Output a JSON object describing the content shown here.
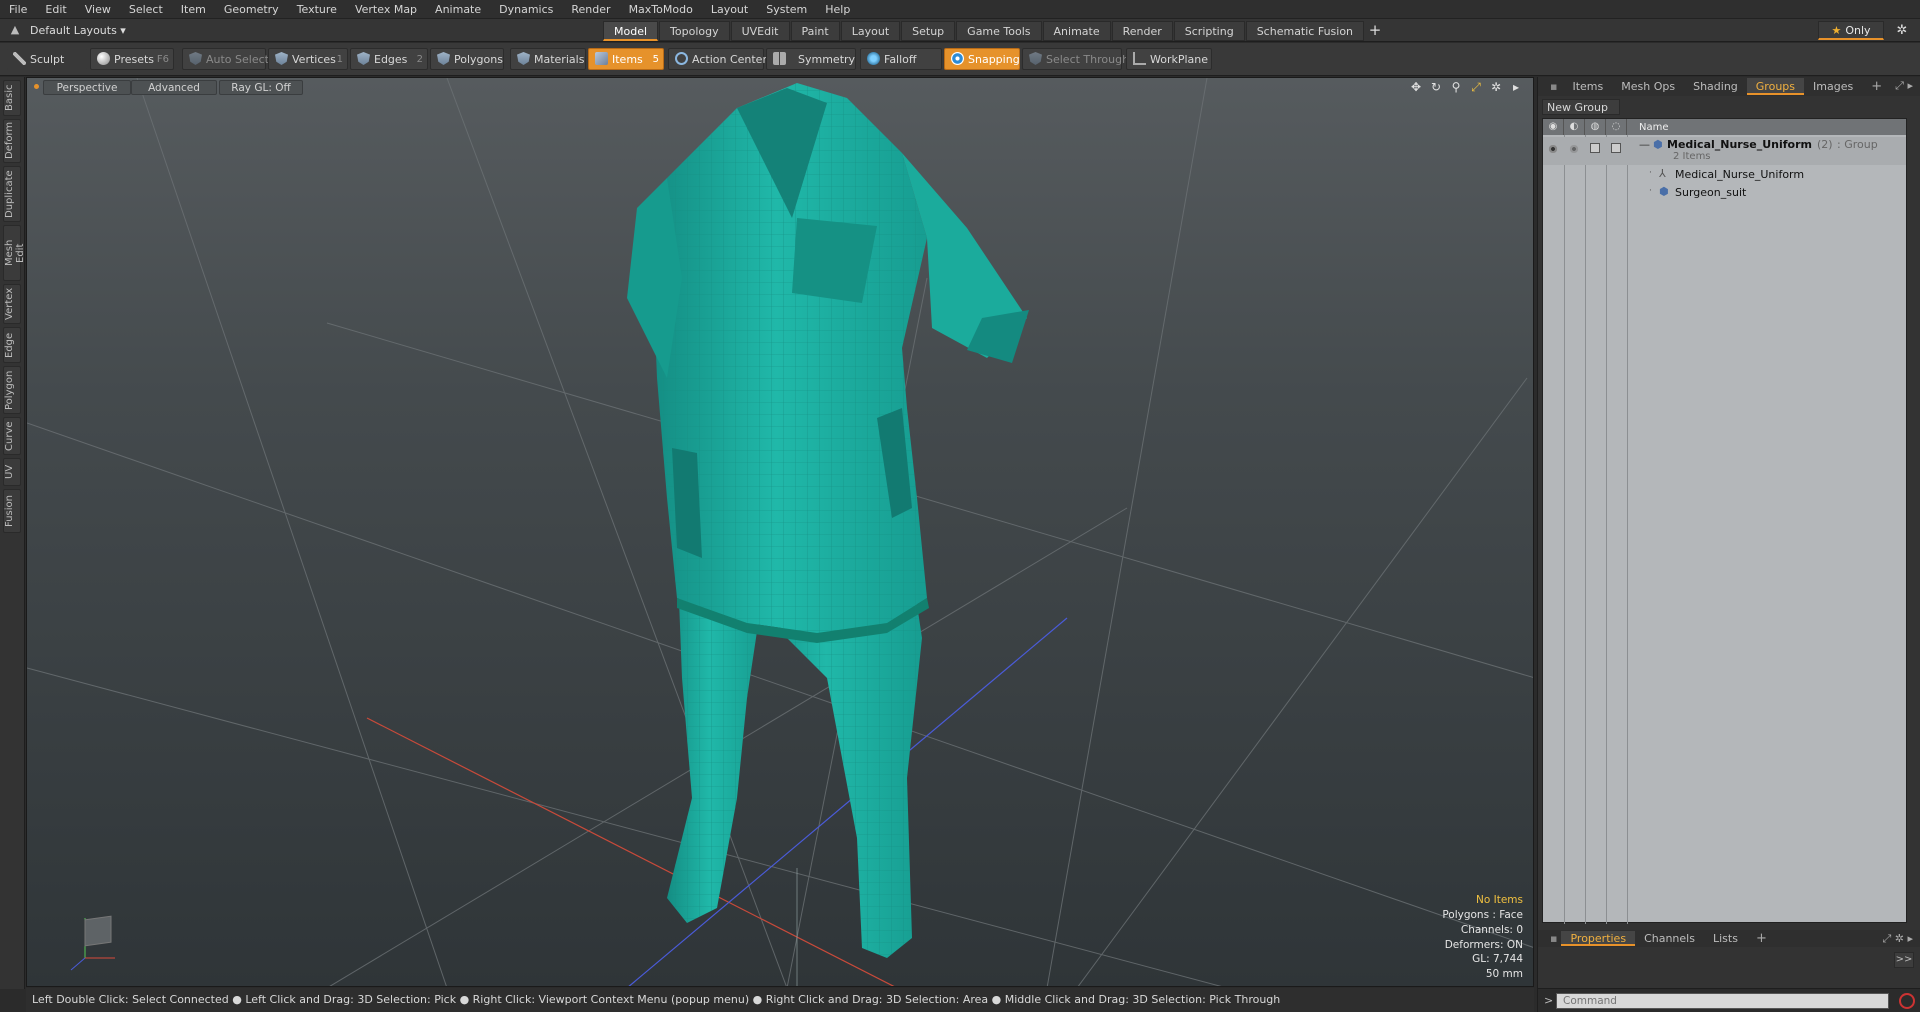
{
  "menu": [
    "File",
    "Edit",
    "View",
    "Select",
    "Item",
    "Geometry",
    "Texture",
    "Vertex Map",
    "Animate",
    "Dynamics",
    "Render",
    "MaxToModo",
    "Layout",
    "System",
    "Help"
  ],
  "layouts_label": "Default Layouts ▾",
  "tabs": [
    "Model",
    "Topology",
    "UVEdit",
    "Paint",
    "Layout",
    "Setup",
    "Game Tools",
    "Animate",
    "Render",
    "Scripting",
    "Schematic Fusion"
  ],
  "tab_add": "+",
  "only_label": "Only",
  "toolbar": {
    "sculpt": "Sculpt",
    "presets": "Presets",
    "presets_key": "F6",
    "auto_select": "Auto Select",
    "vertices": "Vertices",
    "vertices_key": "1",
    "edges": "Edges",
    "edges_key": "2",
    "polygons": "Polygons",
    "materials": "Materials",
    "items": "Items",
    "items_key": "5",
    "action_center": "Action Center",
    "symmetry": "Symmetry",
    "falloff": "Falloff",
    "snapping": "Snapping",
    "select_through": "Select Through",
    "workplane": "WorkPlane"
  },
  "left_tabs": [
    "Basic",
    "Deform",
    "Duplicate",
    "Mesh Edit",
    "Vertex",
    "Edge",
    "Polygon",
    "Curve",
    "UV",
    "Fusion"
  ],
  "viewport": {
    "perspective": "Perspective",
    "advanced": "Advanced",
    "raygl": "Ray GL: Off",
    "info": {
      "no_items": "No Items",
      "polygons": "Polygons : Face",
      "channels": "Channels: 0",
      "deformers": "Deformers: ON",
      "gl": "GL: 7,744",
      "scale": "50 mm"
    }
  },
  "status": "Left Double Click: Select Connected ● Left Click and Drag: 3D Selection: Pick ● Right Click: Viewport Context Menu (popup menu) ● Right Click and Drag: 3D Selection: Area ● Middle Click and Drag: 3D Selection: Pick Through",
  "right_panel": {
    "tabs": [
      "Items",
      "Mesh Ops",
      "Shading",
      "Groups",
      "Images"
    ],
    "active_tab": "Groups",
    "new_group": "New Group",
    "name_col": "Name",
    "group_name": "Medical_Nurse_Uniform",
    "group_count": "(2)",
    "group_type": ": Group",
    "group_items": "2 Items",
    "children": [
      "Medical_Nurse_Uniform",
      "Surgeon_suit"
    ],
    "bottom_tabs": [
      "Properties",
      "Channels",
      "Lists"
    ],
    "command_placeholder": "Command"
  },
  "colors": {
    "accent": "#e8922a",
    "garment": "#1fb5a6"
  }
}
